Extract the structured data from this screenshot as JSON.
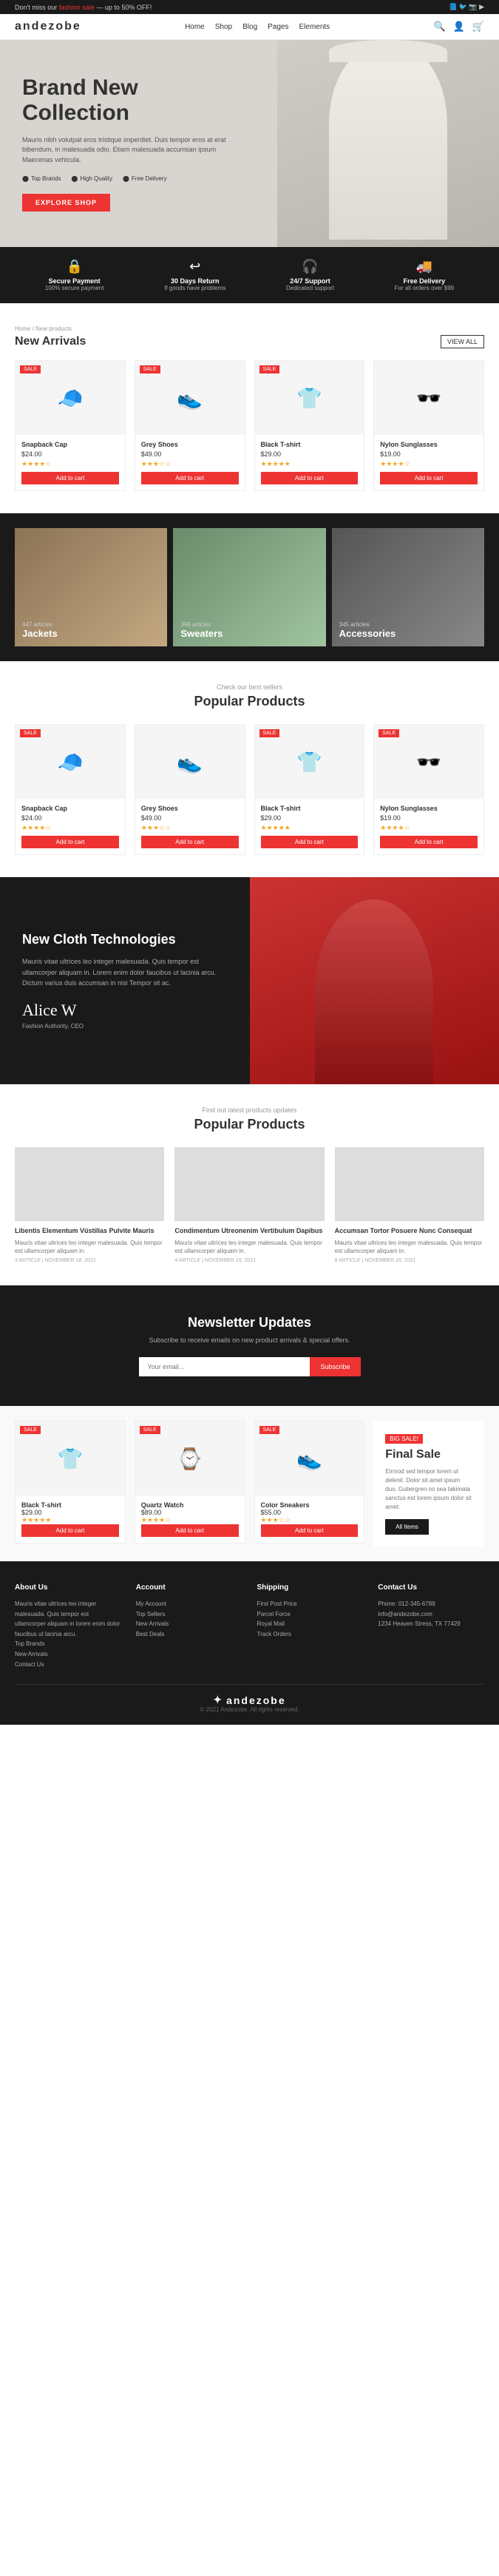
{
  "topbar": {
    "promo": "Don't miss our",
    "promo_link": "fashion sale",
    "promo_discount": "— up to 50% OFF!",
    "social_icons": [
      "fb",
      "tw",
      "ig",
      "yt"
    ]
  },
  "nav": {
    "logo": "andezobe",
    "links": [
      "Home",
      "Shop",
      "Blog",
      "Pages",
      "Elements"
    ],
    "icons": [
      "🔍",
      "👤",
      "🛒"
    ]
  },
  "hero": {
    "title": "Brand New Collection",
    "description": "Mauris nibh volutpat eros tristique imperdiet. Duis tempor eros at erat bibendum, in malesuada odio. Etiam malesuada accumsan ipsum Maecenas vehicula.",
    "feature1": "Top Brands",
    "feature2": "High Quality",
    "feature3": "Free Delivery",
    "cta": "EXPLORE SHOP"
  },
  "features": [
    {
      "icon": "🔒",
      "title": "Secure Payment",
      "sub": "100% secure payment"
    },
    {
      "icon": "↩",
      "title": "30 Days Return",
      "sub": "If goods have problems"
    },
    {
      "icon": "🎧",
      "title": "24/7 Support",
      "sub": "Dedicated support"
    },
    {
      "icon": "🚚",
      "title": "Free Delivery",
      "sub": "For all orders over $99"
    }
  ],
  "new_arrivals": {
    "breadcrumb": "Home / New products",
    "title": "New Arrivals",
    "view_all": "VIEW ALL",
    "products": [
      {
        "name": "Snapback Cap",
        "price": "$24.00",
        "rating": "★★★★☆",
        "badge": "SALE",
        "icon": "🧢"
      },
      {
        "name": "Grey Shoes",
        "price": "$49.00",
        "rating": "★★★☆☆",
        "badge": "SALE",
        "icon": "👟"
      },
      {
        "name": "Black T-shirt",
        "price": "$29.00",
        "rating": "★★★★★",
        "badge": "SALE",
        "icon": "👕"
      },
      {
        "name": "Nylon Sunglasses",
        "price": "$19.00",
        "rating": "★★★★☆",
        "badge": "",
        "icon": "🕶️"
      }
    ],
    "add_to_cart": "Add to cart"
  },
  "categories": [
    {
      "name": "Jackets",
      "count": "447 articles",
      "style": "category-jackets"
    },
    {
      "name": "Sweaters",
      "count": "398 articles",
      "style": "category-sweaters"
    },
    {
      "name": "Accessories",
      "count": "345 articles",
      "style": "category-accessories"
    }
  ],
  "popular_products": {
    "sub": "Check our best sellers",
    "title": "Popular Products",
    "products": [
      {
        "name": "Snapback Cap",
        "price": "$24.00",
        "rating": "★★★★☆",
        "badge": "SALE",
        "icon": "🧢"
      },
      {
        "name": "Grey Shoes",
        "price": "$49.00",
        "rating": "★★★☆☆",
        "badge": "",
        "icon": "👟"
      },
      {
        "name": "Black T-shirt",
        "price": "$29.00",
        "rating": "★★★★★",
        "badge": "SALE",
        "icon": "👕"
      },
      {
        "name": "Nylon Sunglasses",
        "price": "$19.00",
        "rating": "★★★★☆",
        "badge": "SALE",
        "icon": "🕶️"
      }
    ],
    "add_to_cart": "Add to cart"
  },
  "cloth_tech": {
    "title": "New Cloth Technologies",
    "description": "Mauris vitae ultrices leo integer malesuada. Quis tempor est ullamcorper aliquam in. Lorem enim dolor faucibus ut lacinia arcu. Dictum varius duis accumsan in nisi Tempor sit ac.",
    "signature": "Alice W",
    "author_title": "Fashion Authority, CEO"
  },
  "blog": {
    "sub": "Find out latest products updates",
    "title": "Popular Products",
    "posts": [
      {
        "title": "Libentis Elementum Vüstillas Pulvite Mauris",
        "excerpt": "Mauris vitae ultrices leo integer malesuada. Quis tempor est ullamcorper aliquam in.",
        "meta": "3 ARTICLE | NOVEMBER 18, 2021",
        "style": "blog-img-1"
      },
      {
        "title": "Condimentum Utreonenim Vertibulum Dapibus",
        "excerpt": "Mauris vitae ultrices leo integer malesuada. Quis tempor est ullamcorper aliquam in.",
        "meta": "4 ARTICLE | NOVEMBER 19, 2021",
        "style": "blog-img-2"
      },
      {
        "title": "Accumsan Tortor Posuere Nunc Consequat",
        "excerpt": "Mauris vitae ultrices leo integer malesuada. Quis tempor est ullamcorper aliquam in.",
        "meta": "8 ARTICLE | NOVEMBER 20, 2021",
        "style": "blog-img-3"
      }
    ]
  },
  "newsletter": {
    "title": "Newsletter Updates",
    "description": "Subscribe to receive emails on new product arrivals & special offers.",
    "placeholder": "Your email...",
    "button": "Subscribe"
  },
  "final_sale": {
    "tag": "BIG SALE!",
    "title": "Final Sale",
    "description": "Eirmod sed tempor lorem ut delenit. Dolor sit amet ipsum duo. Gubergren no sea takimata sanctus est lorem ipsum dolor sit amet.",
    "btn": "All Items",
    "products": [
      {
        "name": "Black T-shirt",
        "price": "$29.00",
        "rating": "★★★★★",
        "badge": "SALE",
        "icon": "👕"
      },
      {
        "name": "Quartz Watch",
        "price": "$89.00",
        "rating": "★★★★☆",
        "badge": "SALE",
        "icon": "⌚"
      },
      {
        "name": "Color Sneakers",
        "price": "$55.00",
        "rating": "★★★☆☆",
        "badge": "SALE",
        "icon": "👟"
      }
    ],
    "add_to_cart": "Add to cart"
  },
  "footer": {
    "about": {
      "title": "About Us",
      "text": "Mauris vitae ultrices leo integer malesuada. Quis tempor est ullamcorper aliquam in lorem enim dolor faucibus ut lacinia arcu.",
      "links": [
        "Top Brands",
        "New Arrivals",
        "Contact Us"
      ]
    },
    "account": {
      "title": "Account",
      "links": [
        "My Account",
        "Top Sellers",
        "New Arrivals",
        "Best Deals"
      ]
    },
    "shipping": {
      "title": "Shipping",
      "links": [
        "First Post Price",
        "Parcel Force",
        "Royal Mail",
        "Track Orders"
      ]
    },
    "contact": {
      "title": "Contact Us",
      "phone": "Phone: 012-345-6789",
      "email": "info@andezobe.com",
      "address": "1234 Heaven Stress, TX 77429"
    },
    "logo": "andezobe",
    "copyright": "© 2021 Andezobe. All rights reserved."
  }
}
